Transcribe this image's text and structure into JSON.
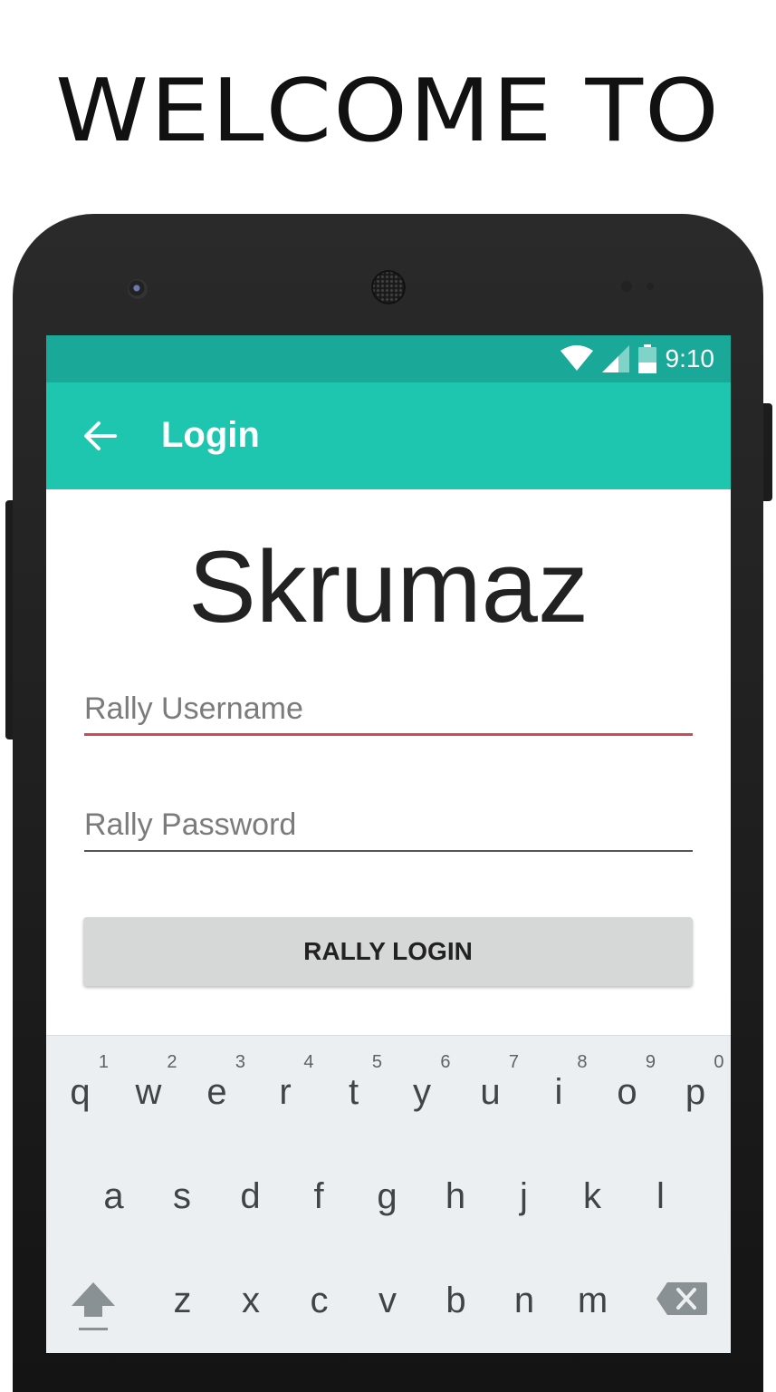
{
  "banner": {
    "headline": "WELCOME TO"
  },
  "status_bar": {
    "time": "9:10",
    "icons": [
      "wifi-icon",
      "cell-signal-icon",
      "battery-icon"
    ]
  },
  "app_bar": {
    "title": "Login",
    "back_icon": "arrow-back-icon"
  },
  "app": {
    "name": "Skrumaz"
  },
  "form": {
    "username_placeholder": "Rally Username",
    "password_placeholder": "Rally Password",
    "login_label": "RALLY LOGIN"
  },
  "keyboard": {
    "row1": [
      {
        "key": "q",
        "hint": "1"
      },
      {
        "key": "w",
        "hint": "2"
      },
      {
        "key": "e",
        "hint": "3"
      },
      {
        "key": "r",
        "hint": "4"
      },
      {
        "key": "t",
        "hint": "5"
      },
      {
        "key": "y",
        "hint": "6"
      },
      {
        "key": "u",
        "hint": "7"
      },
      {
        "key": "i",
        "hint": "8"
      },
      {
        "key": "o",
        "hint": "9"
      },
      {
        "key": "p",
        "hint": "0"
      }
    ],
    "row2": [
      "a",
      "s",
      "d",
      "f",
      "g",
      "h",
      "j",
      "k",
      "l"
    ],
    "row3": [
      "z",
      "x",
      "c",
      "v",
      "b",
      "n",
      "m"
    ],
    "shift_icon": "shift-icon",
    "delete_icon": "backspace-icon"
  },
  "colors": {
    "status_bar": "#1aa898",
    "app_bar": "#1ec6b0",
    "input_focus_line": "#d04a55",
    "button_bg": "#d6d7d7",
    "keyboard_bg": "#eceff1"
  }
}
